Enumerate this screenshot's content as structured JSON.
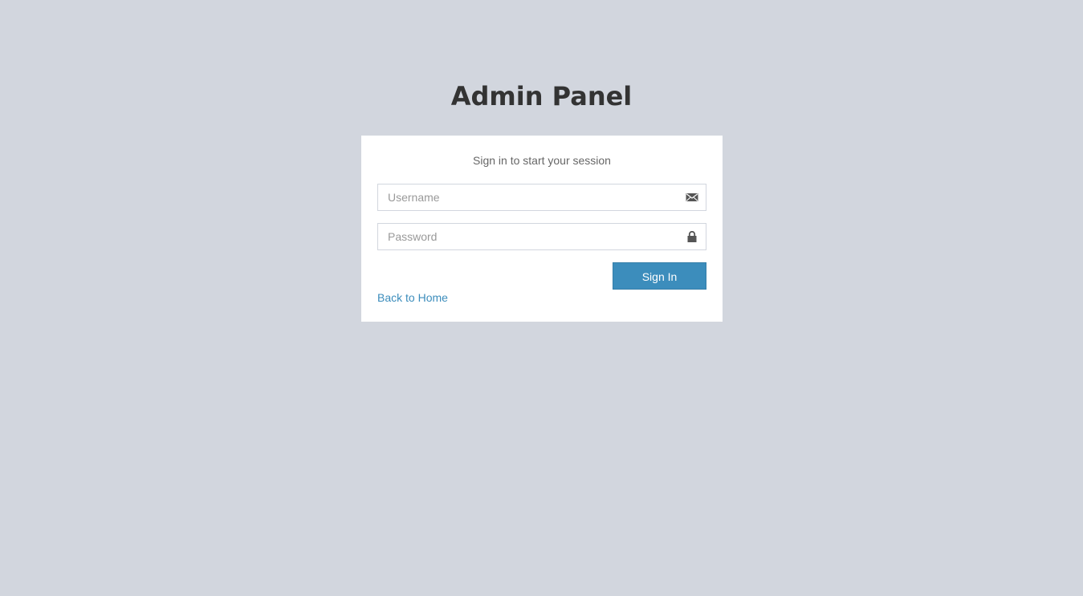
{
  "header": {
    "title": "Admin Panel"
  },
  "login": {
    "message": "Sign in to start your session",
    "username": {
      "placeholder": "Username",
      "value": "",
      "icon": "envelope-icon"
    },
    "password": {
      "placeholder": "Password",
      "value": "",
      "icon": "lock-icon"
    },
    "sign_in_label": "Sign In",
    "back_link_label": "Back to Home"
  },
  "colors": {
    "background": "#d2d6de",
    "box_background": "#ffffff",
    "primary": "#3c8dbc",
    "title_text": "#333333"
  }
}
